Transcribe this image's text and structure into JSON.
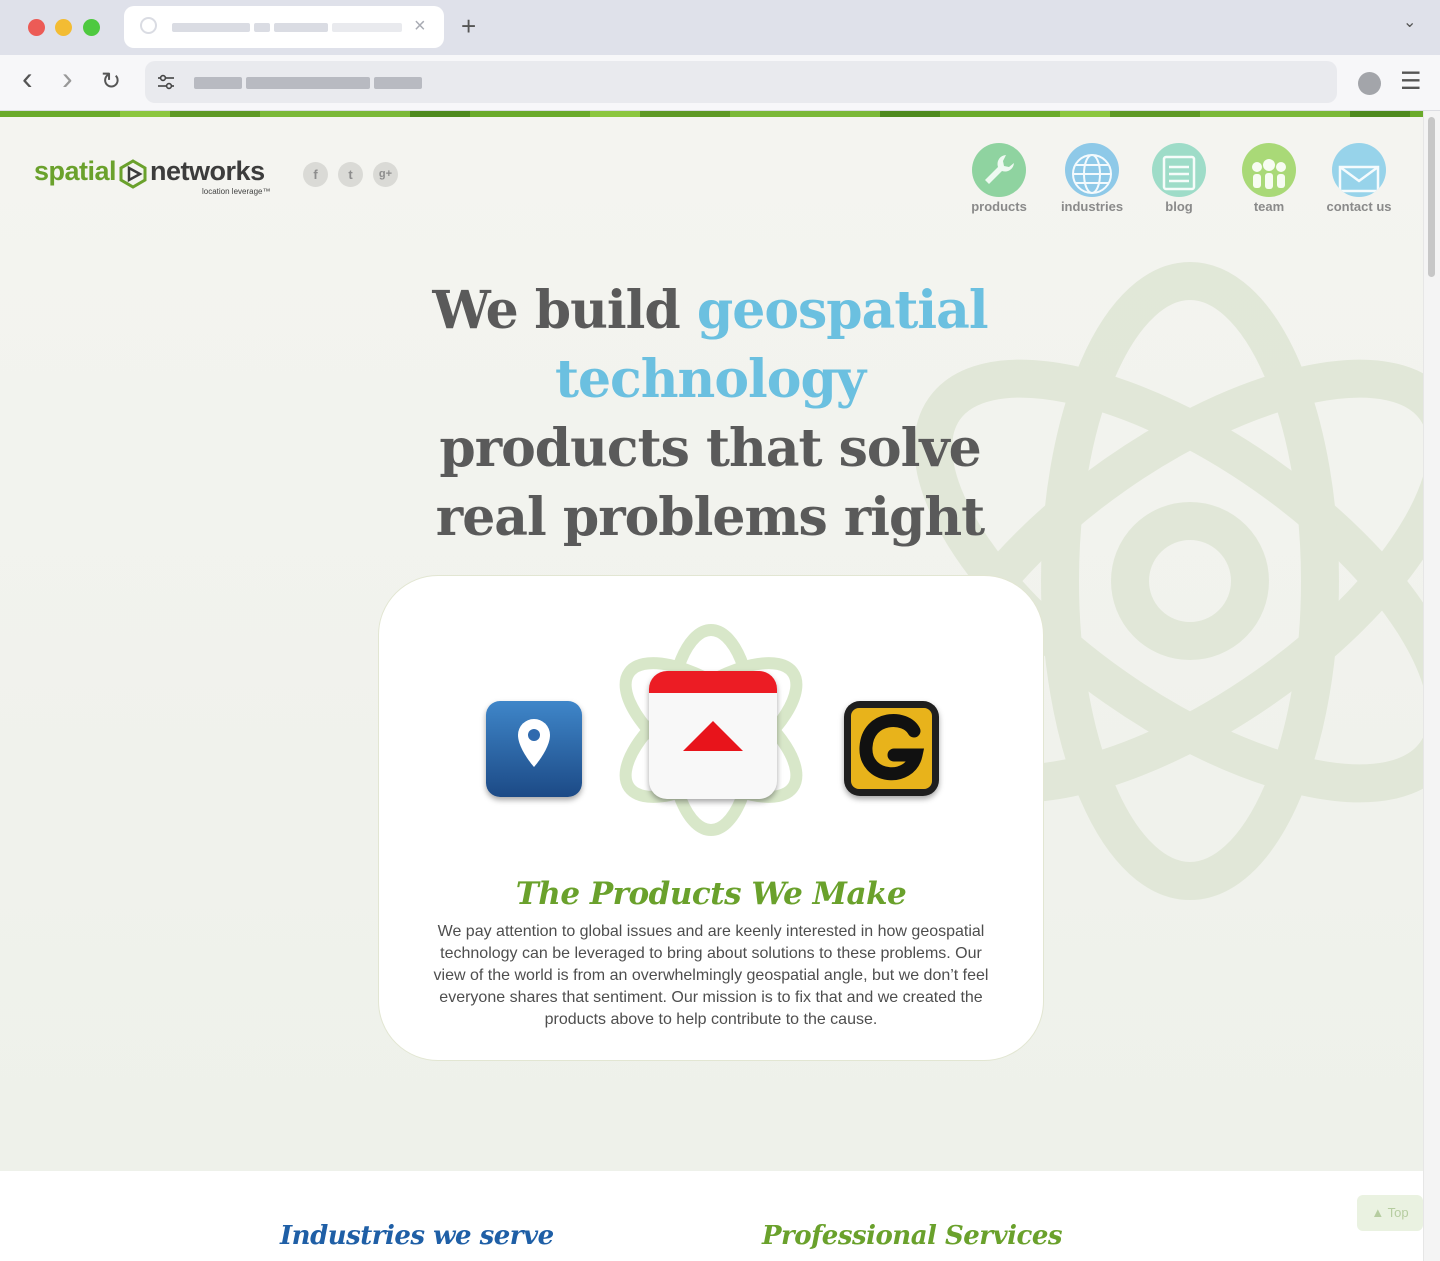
{
  "browser": {
    "new_tab_symbol": "+",
    "tab_close_symbol": "×",
    "back_symbol": "‹",
    "forward_symbol": "›",
    "reload_symbol": "↻",
    "menu_symbol": "☰",
    "tablist_symbol": "⌄"
  },
  "header": {
    "logo_word_1": "spatial",
    "logo_word_2": "networks",
    "logo_tagline": "location leverage™",
    "social": [
      {
        "name": "facebook-icon",
        "glyph": "f"
      },
      {
        "name": "twitter-icon",
        "glyph": "t"
      },
      {
        "name": "google-plus-icon",
        "glyph": "g+"
      }
    ]
  },
  "nav": {
    "items": [
      {
        "label": "products",
        "icon": "wrench-icon",
        "color": "#8fd3a0"
      },
      {
        "label": "industries",
        "icon": "globe-icon",
        "color": "#8ec9e8"
      },
      {
        "label": "blog",
        "icon": "calendar-icon",
        "color": "#9edcc8"
      },
      {
        "label": "team",
        "icon": "people-icon",
        "color": "#a9d977"
      },
      {
        "label": "contact us",
        "icon": "envelope-icon",
        "color": "#97d3ea"
      }
    ]
  },
  "hero": {
    "headline_part1": "We build ",
    "headline_accent": "geospatial technology",
    "headline_part2": "products that solve real problems right now."
  },
  "products_card": {
    "title": "The Products We Make",
    "body": "We pay attention to global issues and are keenly interested in how geospatial technology can be leveraged to bring about solutions to these problems. Our view of the world is from an overwhelmingly geospatial angle, but we don’t feel everyone shares that sentiment. Our mission is to fix that and we created the products above to help contribute to the cause.",
    "apps": [
      "map-pin-app-icon",
      "triangle-app-icon",
      "g-app-icon"
    ]
  },
  "sections": {
    "industries_title": "Industries we serve",
    "services_title": "Professional Services"
  },
  "to_top": {
    "label": "▲ Top"
  },
  "colors": {
    "brand_green": "#6aa12c",
    "accent_blue": "#6bc0e0",
    "industries_blue": "#1f5fa6"
  }
}
